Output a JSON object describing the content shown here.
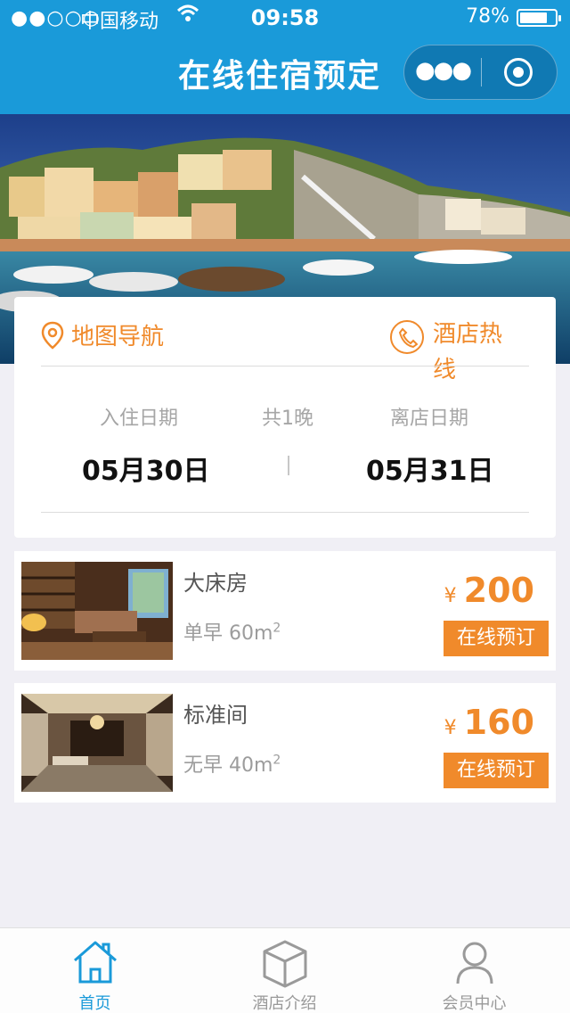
{
  "status_bar": {
    "signal": "●●○○○",
    "carrier": "中国移动",
    "time": "09:58",
    "battery_percent": "78%",
    "battery_level": 0.78
  },
  "nav": {
    "title": "在线住宿预定",
    "more_icon": "more-dots-icon",
    "close_icon": "target-circle-icon"
  },
  "info": {
    "map_nav_label": "地图导航",
    "hotline_label": "酒店热线",
    "checkin_label": "入住日期",
    "nights_label": "共1晚",
    "checkout_label": "离店日期",
    "checkin_date": "05月30日",
    "checkout_date": "05月31日"
  },
  "rooms": [
    {
      "name": "大床房",
      "detail": "单早 60m",
      "price": "200",
      "currency": "¥",
      "book_label": "在线预订"
    },
    {
      "name": "标准间",
      "detail": "无早 40m",
      "price": "160",
      "currency": "¥",
      "book_label": "在线预订"
    }
  ],
  "area_unit_sup": "2",
  "tabs": [
    {
      "label": "首页",
      "icon": "home-icon",
      "active": true
    },
    {
      "label": "酒店介绍",
      "icon": "cube-icon",
      "active": false
    },
    {
      "label": "会员中心",
      "icon": "user-icon",
      "active": false
    }
  ],
  "colors": {
    "primary": "#1a9ad9",
    "accent": "#f08a2b",
    "background": "#f0eff5"
  }
}
